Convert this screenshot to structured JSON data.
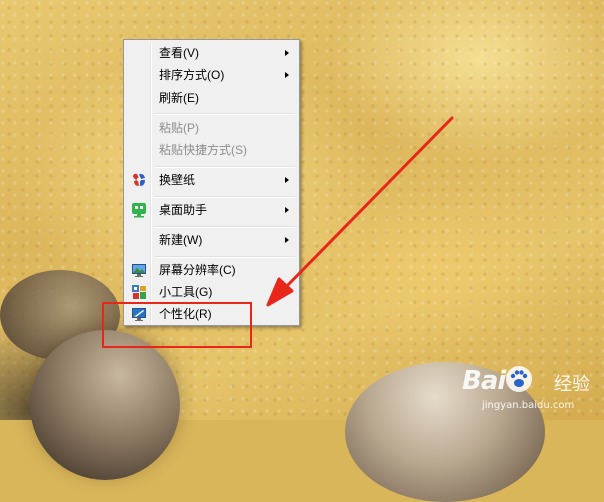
{
  "context_menu": {
    "items": [
      {
        "label": "查看(V)",
        "submenu": true,
        "enabled": true,
        "icon": null
      },
      {
        "label": "排序方式(O)",
        "submenu": true,
        "enabled": true,
        "icon": null
      },
      {
        "label": "刷新(E)",
        "submenu": false,
        "enabled": true,
        "icon": null
      },
      {
        "label": "粘贴(P)",
        "submenu": false,
        "enabled": false,
        "icon": null
      },
      {
        "label": "粘贴快捷方式(S)",
        "submenu": false,
        "enabled": false,
        "icon": null
      },
      {
        "label": "换壁纸",
        "submenu": true,
        "enabled": true,
        "icon": "wallpaper-app-icon"
      },
      {
        "label": "桌面助手",
        "submenu": true,
        "enabled": true,
        "icon": "desktop-assistant-icon"
      },
      {
        "label": "新建(W)",
        "submenu": true,
        "enabled": true,
        "icon": null
      },
      {
        "label": "屏幕分辨率(C)",
        "submenu": false,
        "enabled": true,
        "icon": "monitor-icon"
      },
      {
        "label": "小工具(G)",
        "submenu": false,
        "enabled": true,
        "icon": "gadgets-icon"
      },
      {
        "label": "个性化(R)",
        "submenu": false,
        "enabled": true,
        "icon": "personalize-icon"
      }
    ]
  },
  "annotation": {
    "highlight_color": "#e8261a"
  },
  "watermark": {
    "brand": "Bai",
    "brand_cn": "经验",
    "url": "jingyan.baidu.com"
  }
}
